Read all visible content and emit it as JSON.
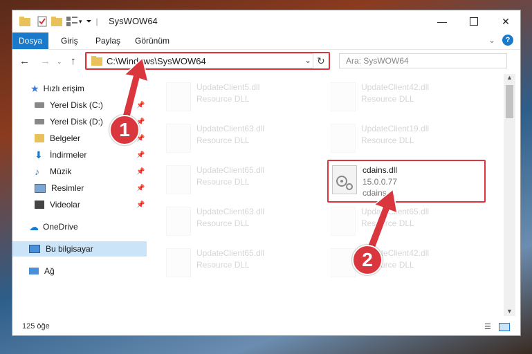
{
  "window": {
    "title": "SysWOW64",
    "controls": [
      "minimize",
      "maximize",
      "close"
    ]
  },
  "ribbon": {
    "tabs": [
      {
        "label": "Dosya",
        "active": true
      },
      {
        "label": "Giriş"
      },
      {
        "label": "Paylaş"
      },
      {
        "label": "Görünüm"
      }
    ]
  },
  "nav": {
    "address": "C:\\Windows\\SysWOW64",
    "search_placeholder": "Ara: SysWOW64"
  },
  "sidebar": {
    "items": [
      {
        "label": "Hızlı erişim",
        "icon": "star-icon"
      },
      {
        "label": "Yerel Disk (C:)",
        "icon": "drive-icon",
        "pinned": true
      },
      {
        "label": "Yerel Disk (D:)",
        "icon": "drive-icon",
        "pinned": true
      },
      {
        "label": "Belgeler",
        "icon": "documents-icon",
        "pinned": true
      },
      {
        "label": "İndirmeler",
        "icon": "download-icon",
        "pinned": true
      },
      {
        "label": "Müzik",
        "icon": "music-icon",
        "pinned": true
      },
      {
        "label": "Resimler",
        "icon": "pictures-icon",
        "pinned": true
      },
      {
        "label": "Videolar",
        "icon": "video-icon",
        "pinned": true
      },
      {
        "label": "OneDrive",
        "icon": "cloud-icon"
      },
      {
        "label": "Bu bilgisayar",
        "icon": "computer-icon",
        "selected": true
      },
      {
        "label": "Ağ",
        "icon": "network-icon"
      }
    ]
  },
  "files": [
    {
      "name": "UpdateClient5.dll",
      "sub": "Resource DLL"
    },
    {
      "name": "UpdateClient42.dll",
      "sub": "Resource DLL"
    },
    {
      "name": "UpdateClient63.dll",
      "sub": "Resource DLL"
    },
    {
      "name": "UpdateClient19.dll",
      "sub": "Resource DLL"
    },
    {
      "name": "UpdateClient65.dll",
      "sub": "Resource DLL"
    },
    {
      "name": "cdains.dll",
      "sub": "15.0.0.77",
      "sub2": "cdains"
    },
    {
      "name": "UpdateClient63.dll",
      "sub": "Resource DLL"
    },
    {
      "name": "UpdateClient65.dll",
      "sub": "Resource DLL"
    },
    {
      "name": "UpdateClient65.dll",
      "sub": "Resource DLL"
    },
    {
      "name": "UpdateClient42.dll",
      "sub": "Resource DLL"
    }
  ],
  "status": {
    "count": "125 öğe"
  },
  "annotations": [
    "1",
    "2"
  ],
  "colors": {
    "accent": "#1979ca",
    "highlight": "#d9363e",
    "selected_bg": "#cce4f7"
  }
}
